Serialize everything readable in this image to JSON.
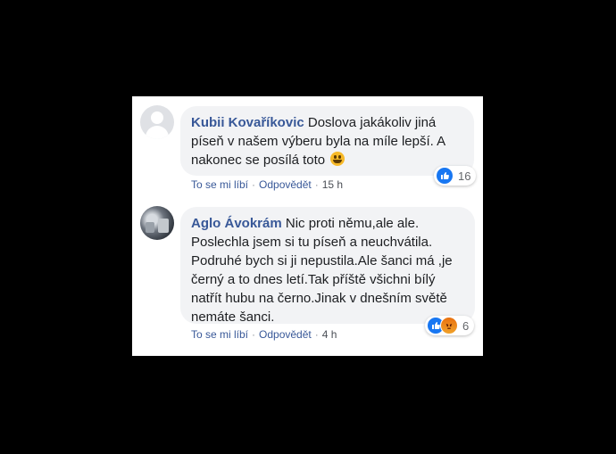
{
  "comments": [
    {
      "author": "Kubii Kovaříkovic",
      "text": "Doslova jakákoliv jiná píseň v našem výberu byla na míle lepší. A nakonec se posílá toto",
      "emoji": "grinning-emoji",
      "reaction_icons": [
        "like-icon"
      ],
      "reaction_count": "16",
      "actions": {
        "like": "To se mi líbí",
        "reply": "Odpovědět",
        "time": "15 h"
      },
      "avatar": "default-avatar"
    },
    {
      "author": "Aglo Ávokrám",
      "text": "Nic proti němu,ale ale. Poslechla jsem si tu píseň a neuchvátila. Podruhé bych si ji nepustila.Ale šanci má ,je černý a to dnes letí.Tak příště všichni bílý natřít hubu na černo.Jinak v dnešním světě nemáte šanci.",
      "reaction_icons": [
        "like-icon",
        "angry-icon"
      ],
      "reaction_count": "6",
      "actions": {
        "like": "To se mi líbí",
        "reply": "Odpovědět",
        "time": "4 h"
      },
      "avatar": "photo-avatar"
    }
  ],
  "colors": {
    "background": "#000000",
    "panel": "#ffffff",
    "bubble": "#f2f3f5",
    "author": "#385898",
    "like": "#1877f2",
    "angry": "#e9710f"
  }
}
